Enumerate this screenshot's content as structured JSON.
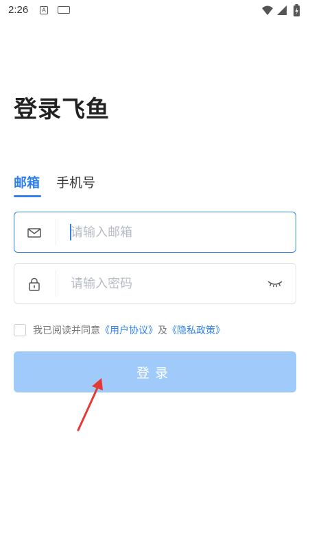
{
  "status_bar": {
    "time": "2:26",
    "notification_icons": [
      "a-icon",
      "keyboard-icon"
    ],
    "system_icons": [
      "wifi-icon",
      "signal-icon",
      "battery-icon"
    ]
  },
  "page": {
    "title": "登录飞鱼"
  },
  "tabs": [
    {
      "label": "邮箱",
      "active": true
    },
    {
      "label": "手机号",
      "active": false
    }
  ],
  "form": {
    "email_placeholder": "请输入邮箱",
    "email_value": "",
    "password_placeholder": "请输入密码",
    "password_value": ""
  },
  "agreement": {
    "prefix": "我已阅读并同意",
    "user_agreement": "《用户协议》",
    "conjunction": "及",
    "privacy_policy": "《隐私政策》"
  },
  "login_button_label": "登录",
  "colors": {
    "accent": "#2f80ed",
    "button_disabled": "#9fcaf9",
    "annotation_arrow": "#e53935"
  }
}
